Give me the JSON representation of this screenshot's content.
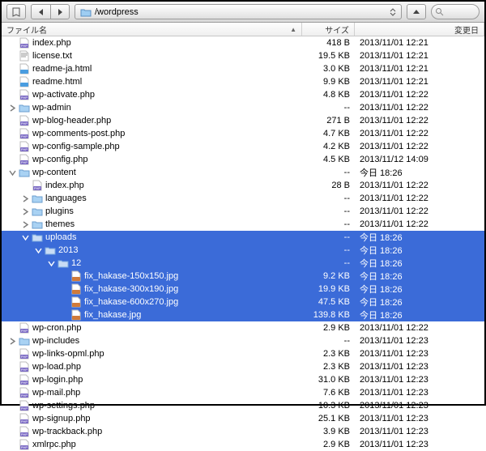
{
  "toolbar": {
    "path": "/wordpress"
  },
  "columns": {
    "name": "ファイル名",
    "size": "サイズ",
    "date": "変更日"
  },
  "rows": [
    {
      "depth": 0,
      "kind": "php",
      "expand": "",
      "name": "index.php",
      "size": "418 B",
      "date": "2013/11/01 12:21",
      "sel": false
    },
    {
      "depth": 0,
      "kind": "txt",
      "expand": "",
      "name": "license.txt",
      "size": "19.5 KB",
      "date": "2013/11/01 12:21",
      "sel": false
    },
    {
      "depth": 0,
      "kind": "html",
      "expand": "",
      "name": "readme-ja.html",
      "size": "3.0 KB",
      "date": "2013/11/01 12:21",
      "sel": false
    },
    {
      "depth": 0,
      "kind": "html",
      "expand": "",
      "name": "readme.html",
      "size": "9.9 KB",
      "date": "2013/11/01 12:21",
      "sel": false
    },
    {
      "depth": 0,
      "kind": "php",
      "expand": "",
      "name": "wp-activate.php",
      "size": "4.8 KB",
      "date": "2013/11/01 12:22",
      "sel": false
    },
    {
      "depth": 0,
      "kind": "folder",
      "expand": "closed",
      "name": "wp-admin",
      "size": "--",
      "date": "2013/11/01 12:22",
      "sel": false
    },
    {
      "depth": 0,
      "kind": "php",
      "expand": "",
      "name": "wp-blog-header.php",
      "size": "271 B",
      "date": "2013/11/01 12:22",
      "sel": false
    },
    {
      "depth": 0,
      "kind": "php",
      "expand": "",
      "name": "wp-comments-post.php",
      "size": "4.7 KB",
      "date": "2013/11/01 12:22",
      "sel": false
    },
    {
      "depth": 0,
      "kind": "php",
      "expand": "",
      "name": "wp-config-sample.php",
      "size": "4.2 KB",
      "date": "2013/11/01 12:22",
      "sel": false
    },
    {
      "depth": 0,
      "kind": "php",
      "expand": "",
      "name": "wp-config.php",
      "size": "4.5 KB",
      "date": "2013/11/12 14:09",
      "sel": false
    },
    {
      "depth": 0,
      "kind": "folder",
      "expand": "open",
      "name": "wp-content",
      "size": "--",
      "date": "今日 18:26",
      "sel": false
    },
    {
      "depth": 1,
      "kind": "php",
      "expand": "",
      "name": "index.php",
      "size": "28 B",
      "date": "2013/11/01 12:22",
      "sel": false
    },
    {
      "depth": 1,
      "kind": "folder",
      "expand": "closed",
      "name": "languages",
      "size": "--",
      "date": "2013/11/01 12:22",
      "sel": false
    },
    {
      "depth": 1,
      "kind": "folder",
      "expand": "closed",
      "name": "plugins",
      "size": "--",
      "date": "2013/11/01 12:22",
      "sel": false
    },
    {
      "depth": 1,
      "kind": "folder",
      "expand": "closed",
      "name": "themes",
      "size": "--",
      "date": "2013/11/01 12:22",
      "sel": false
    },
    {
      "depth": 1,
      "kind": "folder",
      "expand": "open",
      "name": "uploads",
      "size": "--",
      "date": "今日 18:26",
      "sel": true
    },
    {
      "depth": 2,
      "kind": "folder",
      "expand": "open",
      "name": "2013",
      "size": "--",
      "date": "今日 18:26",
      "sel": true
    },
    {
      "depth": 3,
      "kind": "folder",
      "expand": "open",
      "name": "12",
      "size": "--",
      "date": "今日 18:26",
      "sel": true
    },
    {
      "depth": 4,
      "kind": "jpg",
      "expand": "",
      "name": "fix_hakase-150x150.jpg",
      "size": "9.2 KB",
      "date": "今日 18:26",
      "sel": true
    },
    {
      "depth": 4,
      "kind": "jpg",
      "expand": "",
      "name": "fix_hakase-300x190.jpg",
      "size": "19.9 KB",
      "date": "今日 18:26",
      "sel": true
    },
    {
      "depth": 4,
      "kind": "jpg",
      "expand": "",
      "name": "fix_hakase-600x270.jpg",
      "size": "47.5 KB",
      "date": "今日 18:26",
      "sel": true
    },
    {
      "depth": 4,
      "kind": "jpg",
      "expand": "",
      "name": "fix_hakase.jpg",
      "size": "139.8 KB",
      "date": "今日 18:26",
      "sel": true
    },
    {
      "depth": 0,
      "kind": "php",
      "expand": "",
      "name": "wp-cron.php",
      "size": "2.9 KB",
      "date": "2013/11/01 12:22",
      "sel": false
    },
    {
      "depth": 0,
      "kind": "folder",
      "expand": "closed",
      "name": "wp-includes",
      "size": "--",
      "date": "2013/11/01 12:23",
      "sel": false
    },
    {
      "depth": 0,
      "kind": "php",
      "expand": "",
      "name": "wp-links-opml.php",
      "size": "2.3 KB",
      "date": "2013/11/01 12:23",
      "sel": false
    },
    {
      "depth": 0,
      "kind": "php",
      "expand": "",
      "name": "wp-load.php",
      "size": "2.3 KB",
      "date": "2013/11/01 12:23",
      "sel": false
    },
    {
      "depth": 0,
      "kind": "php",
      "expand": "",
      "name": "wp-login.php",
      "size": "31.0 KB",
      "date": "2013/11/01 12:23",
      "sel": false
    },
    {
      "depth": 0,
      "kind": "php",
      "expand": "",
      "name": "wp-mail.php",
      "size": "7.6 KB",
      "date": "2013/11/01 12:23",
      "sel": false
    },
    {
      "depth": 0,
      "kind": "php",
      "expand": "",
      "name": "wp-settings.php",
      "size": "10.3 KB",
      "date": "2013/11/01 12:23",
      "sel": false
    },
    {
      "depth": 0,
      "kind": "php",
      "expand": "",
      "name": "wp-signup.php",
      "size": "25.1 KB",
      "date": "2013/11/01 12:23",
      "sel": false
    },
    {
      "depth": 0,
      "kind": "php",
      "expand": "",
      "name": "wp-trackback.php",
      "size": "3.9 KB",
      "date": "2013/11/01 12:23",
      "sel": false
    },
    {
      "depth": 0,
      "kind": "php",
      "expand": "",
      "name": "xmlrpc.php",
      "size": "2.9 KB",
      "date": "2013/11/01 12:23",
      "sel": false
    }
  ]
}
